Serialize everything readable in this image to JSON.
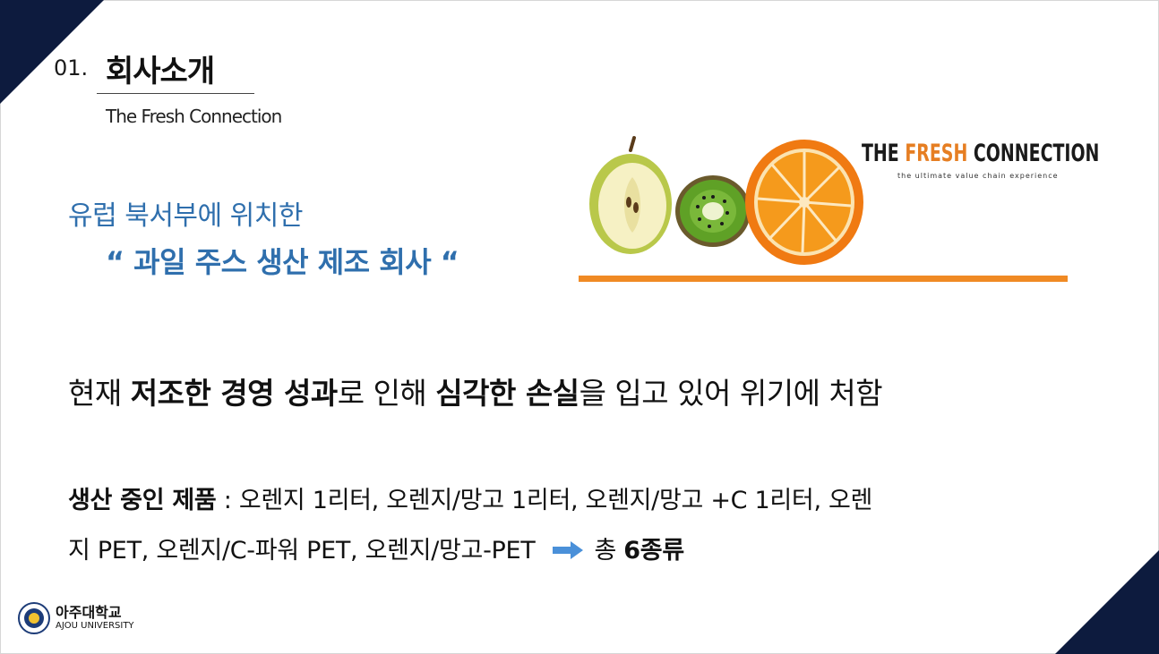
{
  "header": {
    "section_number": "01.",
    "section_title": "회사소개",
    "subtitle": "The Fresh Connection"
  },
  "headline": {
    "line1": "유럽 북서부에 위치한",
    "line2": "“ 과일 주스 생산 제조 회사 “"
  },
  "brand": {
    "part1": "THE ",
    "part2": "FRESH",
    "part3": " CONNECTION",
    "tagline": "the ultimate value chain experience"
  },
  "status": {
    "s1": "현재 ",
    "s2": "저조한 경영 성과",
    "s3": "로 인해 ",
    "s4": "심각한 손실",
    "s5": "을 입고 있어 위기에 처함"
  },
  "products": {
    "label": "생산 중인 제품",
    "line1_rest": " : 오렌지 1리터, 오렌지/망고 1리터, 오렌지/망고 +C 1리터, 오렌",
    "line2": "지 PET, 오렌지/C-파워 PET, 오렌지/망고-PET",
    "total_prefix": "총 ",
    "total_value": "6종류"
  },
  "logo": {
    "korean": "아주대학교",
    "english": "AJOU UNIVERSITY"
  },
  "colors": {
    "navy": "#0d1b3e",
    "accent_blue": "#2f6fad",
    "orange": "#f08a24",
    "arrow_blue": "#4a90d9"
  }
}
